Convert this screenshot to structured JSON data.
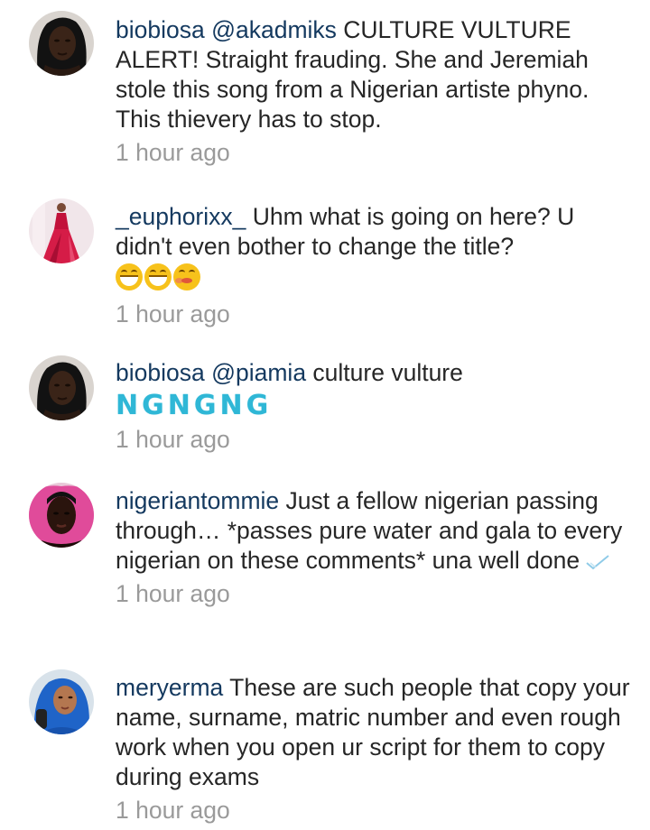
{
  "comments": [
    {
      "username": "biobiosa",
      "mention": "@akadmiks",
      "text": " CULTURE VULTURE ALERT! Straight frauding. She and Jeremiah stole this song from a Nigerian artiste phyno. This thievery has to stop.",
      "time": "1 hour ago"
    },
    {
      "username": "_euphorixx_",
      "text": " Uhm what is going on here? U didn't even bother to change the title? ",
      "unrendered_glyphs": "",
      "emojis": [
        "grinning-tears-emoji",
        "grinning-tears-emoji",
        "tired-face-emoji"
      ],
      "time": "1 hour ago"
    },
    {
      "username": "biobiosa",
      "mention": "@piamia",
      "text": " culture vulture",
      "styled_text": "NGNGNG",
      "time": "1 hour ago"
    },
    {
      "username": "nigeriantommie",
      "text": " Just a fellow nigerian passing through… *passes pure water and gala to every nigerian on these comments* una well done",
      "time": "1 hour ago"
    },
    {
      "username": "meryerma",
      "text": " These are such people that copy your name, surname, matric number and even rough work when you open ur script for them to copy during exams",
      "time": "1 hour ago"
    }
  ],
  "colors": {
    "username": "#14395f",
    "text": "#262626",
    "timestamp": "#9a9a9a",
    "styled_text": "#2fb7d6"
  }
}
